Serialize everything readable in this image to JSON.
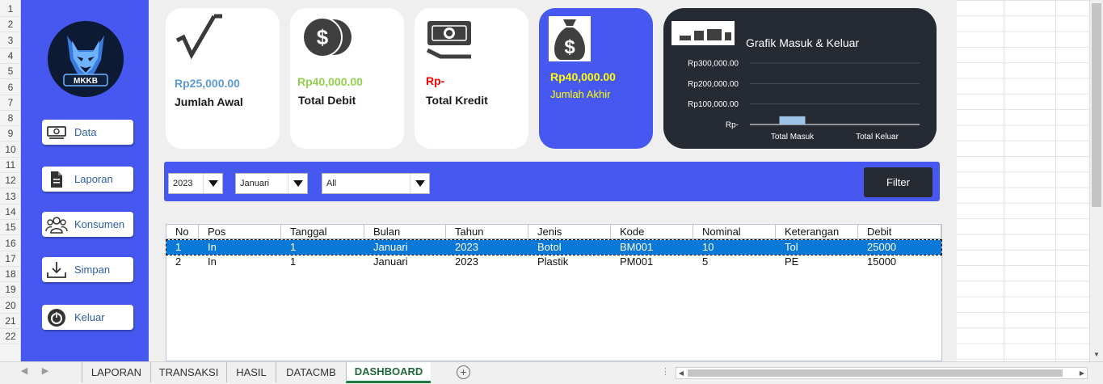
{
  "row_numbers": [
    "1",
    "2",
    "3",
    "4",
    "5",
    "6",
    "7",
    "8",
    "9",
    "10",
    "11",
    "12",
    "13",
    "14",
    "15",
    "16",
    "17",
    "18",
    "19",
    "20",
    "21",
    "22"
  ],
  "sidebar": {
    "logo_text": "MKKB",
    "items": [
      {
        "label": "Data",
        "icon": "money-icon"
      },
      {
        "label": "Laporan",
        "icon": "document-icon"
      },
      {
        "label": "Konsumen",
        "icon": "users-icon"
      },
      {
        "label": "Simpan",
        "icon": "download-icon"
      },
      {
        "label": "Keluar",
        "icon": "power-icon"
      }
    ]
  },
  "cards": [
    {
      "amount": "Rp25,000.00",
      "caption": "Jumlah Awal",
      "icon": "square-root-icon",
      "amount_color": "#5b9bd5"
    },
    {
      "amount": "Rp40,000.00",
      "caption": "Total Debit",
      "icon": "coins-dollar-icon",
      "amount_color": "#92d050"
    },
    {
      "amount": "Rp-",
      "caption": "Total Kredit",
      "icon": "banknote-icon",
      "amount_color": "#ff0000"
    },
    {
      "amount": "Rp40,000.00",
      "caption": "Jumlah Akhir",
      "icon": "money-bag-icon",
      "amount_color": "#ffff00"
    }
  ],
  "chart_data": {
    "type": "bar",
    "title": "Grafik Masuk & Keluar",
    "categories": [
      "Total Masuk",
      "Total Keluar"
    ],
    "values": [
      40000,
      0
    ],
    "y_tick_labels": [
      "Rp300,000.00",
      "Rp200,000.00",
      "Rp100,000.00",
      "Rp-"
    ],
    "y_ticks": [
      300000,
      200000,
      100000,
      0
    ],
    "ylim": [
      0,
      300000
    ],
    "grid": true,
    "bar_color": "#9dc3e6"
  },
  "filters": {
    "year": "2023",
    "month": "Januari",
    "category": "All",
    "button_label": "Filter"
  },
  "table": {
    "columns": [
      "No",
      "Pos",
      "Tanggal",
      "Bulan",
      "Tahun",
      "Jenis",
      "Kode",
      "Nominal",
      "Keterangan",
      "Debit"
    ],
    "rows": [
      [
        "1",
        "In",
        "1",
        "Januari",
        "2023",
        "Botol",
        "BM001",
        "10",
        "Tol",
        "25000"
      ],
      [
        "2",
        "In",
        "1",
        "Januari",
        "2023",
        "Plastik",
        "PM001",
        "5",
        "PE",
        "15000"
      ]
    ],
    "selected_row": 0
  },
  "sheet_tabs": [
    "LAPORAN",
    "TRANSAKSI",
    "HASIL",
    "DATACMB",
    "DASHBOARD"
  ],
  "active_tab": "DASHBOARD"
}
